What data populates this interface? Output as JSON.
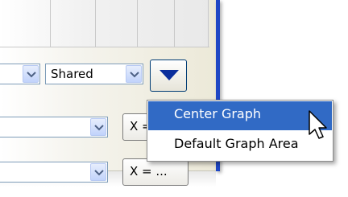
{
  "combo_top": {
    "value": "Shared"
  },
  "chevron_button": {
    "icon": "chevron-down-icon"
  },
  "rows": [
    {
      "button_label": "X = ..."
    },
    {
      "button_label": "X = ..."
    }
  ],
  "context_menu": {
    "items": [
      {
        "label": "Center Graph",
        "highlighted": true
      },
      {
        "label": "Default Graph Area",
        "highlighted": false
      }
    ]
  },
  "colors": {
    "highlight": "#316ac5",
    "accent_bar": "#1f47c4",
    "chevron": "#0a2e9c"
  }
}
